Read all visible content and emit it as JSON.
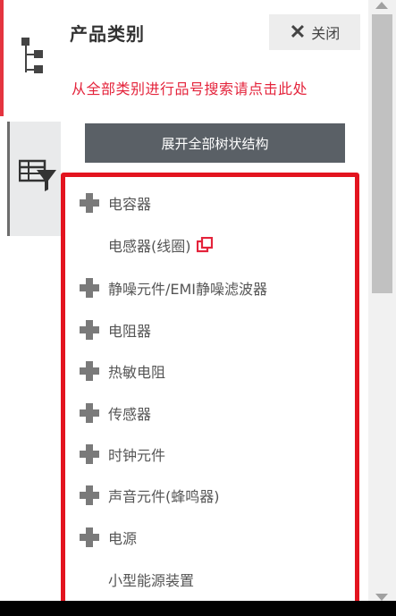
{
  "panel": {
    "title": "产品类别",
    "close_label": "关闭",
    "search_link": "从全部类别进行品号搜索请点击此处",
    "expand_label": "展开全部树状结构"
  },
  "tabs": [
    {
      "icon": "tree-icon",
      "active": true
    },
    {
      "icon": "table-filter-icon",
      "active": false
    }
  ],
  "tree": {
    "items": [
      {
        "label": "电容器",
        "expandable": true
      },
      {
        "label": "电感器(线圈)",
        "expandable": false,
        "external": true
      },
      {
        "label": "静噪元件/EMI静噪滤波器",
        "expandable": true
      },
      {
        "label": "电阻器",
        "expandable": true
      },
      {
        "label": "热敏电阻",
        "expandable": true
      },
      {
        "label": "传感器",
        "expandable": true
      },
      {
        "label": "时钟元件",
        "expandable": true
      },
      {
        "label": "声音元件(蜂鸣器)",
        "expandable": true
      },
      {
        "label": "电源",
        "expandable": true
      },
      {
        "label": "小型能源装置",
        "expandable": false
      }
    ]
  },
  "colors": {
    "accent_red": "#e4233b",
    "highlight_border": "#e3141f",
    "button_dark": "#5a6066",
    "plus_gray": "#7a7a7a"
  }
}
